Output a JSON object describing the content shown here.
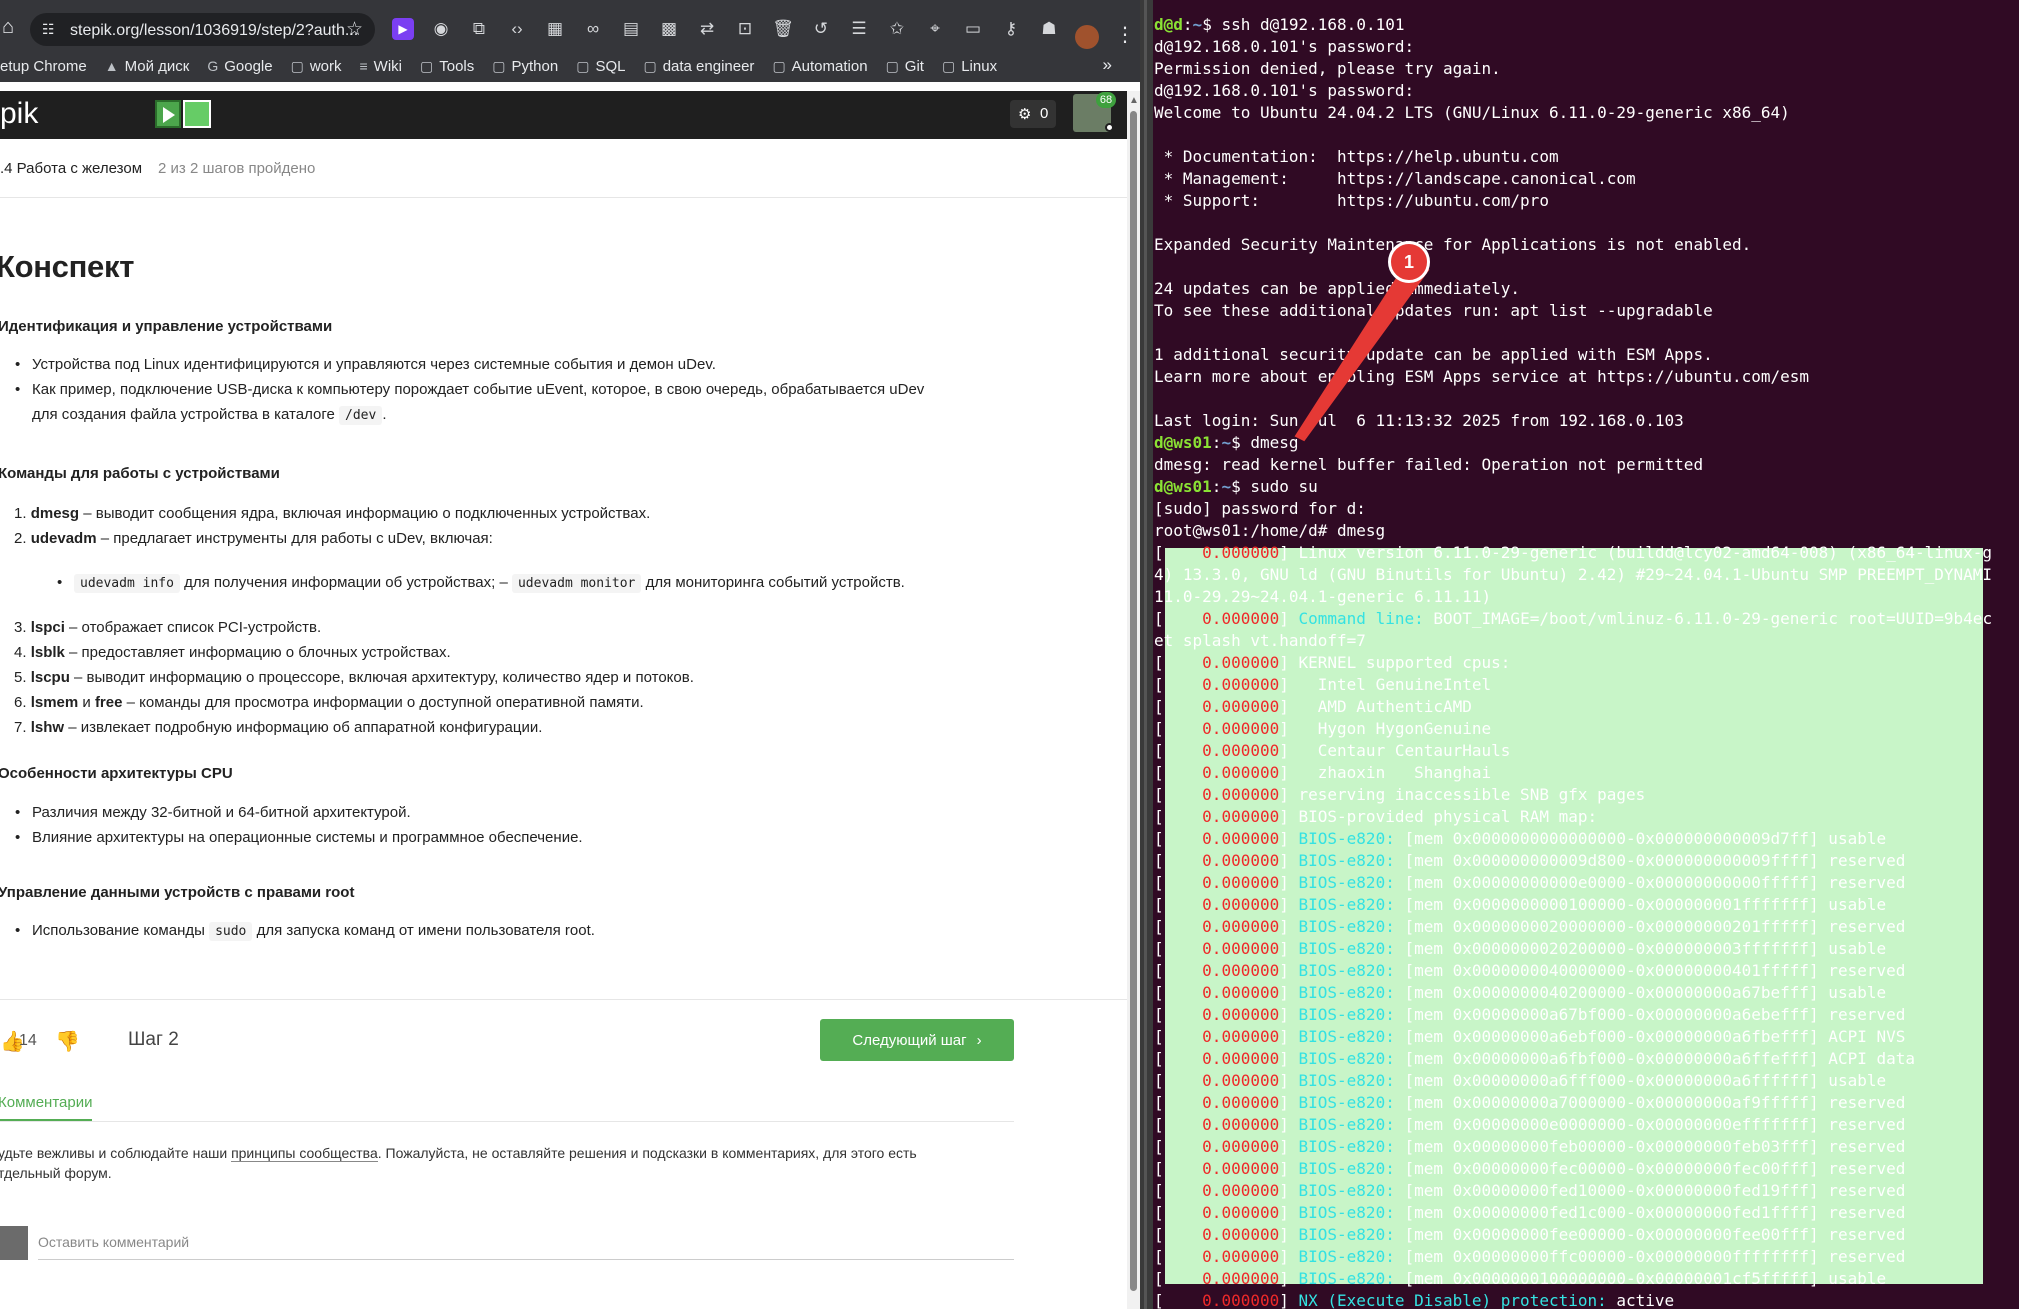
{
  "browser": {
    "url": "stepik.org/lesson/1036919/step/2?auth...",
    "extensions": [
      "play-icon",
      "globe-icon",
      "puzzle-icon",
      "code-icon",
      "table-icon",
      "link-icon",
      "reader-icon",
      "qr-icon",
      "translate-icon",
      "capture-icon",
      "trash-icon",
      "history-icon",
      "list-icon",
      "star-outline-icon",
      "location-icon",
      "card-icon",
      "key-icon",
      "incognito-icon"
    ],
    "bookmarks": [
      {
        "label": "etup Chrome",
        "icon": "page-icon"
      },
      {
        "label": "Мой диск",
        "icon": "drive-icon"
      },
      {
        "label": "Google",
        "icon": "google-icon"
      },
      {
        "label": "work",
        "icon": "folder-icon"
      },
      {
        "label": "Wiki",
        "icon": "wiki-icon"
      },
      {
        "label": "Tools",
        "icon": "folder-icon"
      },
      {
        "label": "Python",
        "icon": "folder-icon"
      },
      {
        "label": "SQL",
        "icon": "folder-icon"
      },
      {
        "label": "data engineer",
        "icon": "folder-icon"
      },
      {
        "label": "Automation",
        "icon": "folder-icon"
      },
      {
        "label": "Git",
        "icon": "folder-icon"
      },
      {
        "label": "Linux",
        "icon": "folder-icon"
      }
    ],
    "more": "»"
  },
  "stepik": {
    "logo": "pik",
    "notifications": "0",
    "user_badge": "68",
    "lesson_title": ".4 Работа с железом",
    "lesson_progress": "2 из 2 шагов пройдено",
    "heading": "Конспект",
    "sections": {
      "s1": "Идентификация и управление устройствами",
      "s2": "Команды для работы с устройствами",
      "s3": "Особенности архитектуры CPU",
      "s4": "Управление данными устройств с правами root"
    },
    "s1_items": [
      "Устройства под Linux идентифицируются и управляются через системные события и демон uDev.",
      "Как пример, подключение USB-диска к компьютеру порождает событие uEvent, которое, в свою очередь, обрабатывается uDev",
      "для создания файла устройства в каталоге"
    ],
    "s1_code": "/dev",
    "s1_after": ".",
    "cmds": [
      {
        "num": "1.",
        "cmd": "dmesg",
        "desc": " – выводит сообщения ядра, включая информацию о подключенных устройствах."
      },
      {
        "num": "2.",
        "cmd": "udevadm",
        "desc": " – предлагает инструменты для работы с uDev, включая:"
      }
    ],
    "udev_code1": "udevadm info",
    "udev_mid": "для получения информации об устройствах; –",
    "udev_code2": "udevadm monitor",
    "udev_end": "для мониторинга событий устройств.",
    "cmds2": [
      {
        "num": "3.",
        "cmd": "lspci",
        "desc": " – отображает список PCI-устройств."
      },
      {
        "num": "4.",
        "cmd": "lsblk",
        "desc": " – предоставляет информацию о блочных устройствах."
      },
      {
        "num": "5.",
        "cmd": "lscpu",
        "desc": " – выводит информацию о процессоре, включая архитектуру, количество ядер и потоков."
      },
      {
        "num": "6.",
        "cmd": "lsmem",
        "desc2": " и ",
        "cmd2": "free",
        "desc": " – команды для просмотра информации о доступной оперативной памяти."
      },
      {
        "num": "7.",
        "cmd": "lshw",
        "desc": " – извлекает подробную информацию об аппаратной конфигурации."
      }
    ],
    "s3_items": [
      "Различия между 32-битной и 64-битной архитектурой.",
      "Влияние архитектуры на операционные системы и программное обеспечение."
    ],
    "s4_before": "Использование команды",
    "s4_code": "sudo",
    "s4_after": "для запуска команд от имени пользователя root.",
    "likes": "14",
    "step_label": "Шаг 2",
    "next_button": "Следующий шаг",
    "comments_tab": "Комментарии",
    "rules_1": "удьте вежливы и соблюдайте наши ",
    "rules_link": "принципы сообщества",
    "rules_2": ". Пожалуйста, не оставляйте решения и подсказки в комментариях, для этого есть",
    "rules_3": "тдельный форум.",
    "comment_placeholder": "Оставить комментарий"
  },
  "annotation": {
    "badge": "1",
    "color": "#e53935"
  },
  "terminal": {
    "lines": [
      {
        "type": "prompt",
        "user": "d@d",
        "path": "~",
        "cmd": "ssh d@192.168.0.101"
      },
      {
        "type": "plain",
        "text": "d@192.168.0.101's password:"
      },
      {
        "type": "plain",
        "text": "Permission denied, please try again."
      },
      {
        "type": "plain",
        "text": "d@192.168.0.101's password:"
      },
      {
        "type": "plain",
        "text": "Welcome to Ubuntu 24.04.2 LTS (GNU/Linux 6.11.0-29-generic x86_64)"
      },
      {
        "type": "plain",
        "text": ""
      },
      {
        "type": "plain",
        "text": " * Documentation:  https://help.ubuntu.com"
      },
      {
        "type": "plain",
        "text": " * Management:     https://landscape.canonical.com"
      },
      {
        "type": "plain",
        "text": " * Support:        https://ubuntu.com/pro"
      },
      {
        "type": "plain",
        "text": ""
      },
      {
        "type": "plain",
        "text": "Expanded Security Maintenance for Applications is not enabled."
      },
      {
        "type": "plain",
        "text": ""
      },
      {
        "type": "plain",
        "text": "24 updates can be applied immediately."
      },
      {
        "type": "plain",
        "text": "To see these additional updates run: apt list --upgradable"
      },
      {
        "type": "plain",
        "text": ""
      },
      {
        "type": "plain",
        "text": "1 additional security update can be applied with ESM Apps."
      },
      {
        "type": "plain",
        "text": "Learn more about enabling ESM Apps service at https://ubuntu.com/esm"
      },
      {
        "type": "plain",
        "text": ""
      },
      {
        "type": "plain",
        "text": "Last login: Sun Jul  6 11:13:32 2025 from 192.168.0.103"
      },
      {
        "type": "prompt",
        "user": "d@ws01",
        "path": "~",
        "cmd": "dmesg"
      },
      {
        "type": "plain",
        "text": "dmesg: read kernel buffer failed: Operation not permitted"
      },
      {
        "type": "prompt",
        "user": "d@ws01",
        "path": "~",
        "cmd": "sudo su"
      },
      {
        "type": "plain",
        "text": "[sudo] password for d:"
      },
      {
        "type": "plain",
        "text": "root@ws01:/home/d# dmesg"
      },
      {
        "type": "kern",
        "ts": "    0.000000",
        "text": "Linux version 6.11.0-29-generic (buildd@lcy02-amd64-008) (x86_64-linux-g"
      },
      {
        "type": "hl",
        "text": "4) 13.3.0, GNU ld (GNU Binutils for Ubuntu) 2.42) #29~24.04.1-Ubuntu SMP PREEMPT_DYNAMI"
      },
      {
        "type": "hl",
        "text": "11.0-29.29~24.04.1-generic 6.11.11)"
      },
      {
        "type": "kernbios",
        "ts": "    0.000000",
        "tag": "Command line:",
        "text": " BOOT_IMAGE=/boot/vmlinuz-6.11.0-29-generic root=UUID=9b4ec"
      },
      {
        "type": "hl",
        "text": "et splash vt.handoff=7"
      },
      {
        "type": "kern",
        "ts": "    0.000000",
        "text": "KERNEL supported cpus:"
      },
      {
        "type": "kern",
        "ts": "    0.000000",
        "text": "  Intel GenuineIntel"
      },
      {
        "type": "kern",
        "ts": "    0.000000",
        "text": "  AMD AuthenticAMD"
      },
      {
        "type": "kern",
        "ts": "    0.000000",
        "text": "  Hygon HygonGenuine"
      },
      {
        "type": "kern",
        "ts": "    0.000000",
        "text": "  Centaur CentaurHauls"
      },
      {
        "type": "kern",
        "ts": "    0.000000",
        "text": "  zhaoxin   Shanghai"
      },
      {
        "type": "kern",
        "ts": "    0.000000",
        "text": "reserving inaccessible SNB gfx pages"
      },
      {
        "type": "kern",
        "ts": "    0.000000",
        "text": "BIOS-provided physical RAM map:"
      },
      {
        "type": "kernbios",
        "ts": "    0.000000",
        "tag": "BIOS-e820:",
        "text": " [mem 0x0000000000000000-0x000000000009d7ff] usable"
      },
      {
        "type": "kernbios",
        "ts": "    0.000000",
        "tag": "BIOS-e820:",
        "text": " [mem 0x000000000009d800-0x000000000009ffff] reserved"
      },
      {
        "type": "kernbios",
        "ts": "    0.000000",
        "tag": "BIOS-e820:",
        "text": " [mem 0x00000000000e0000-0x00000000000fffff] reserved"
      },
      {
        "type": "kernbios",
        "ts": "    0.000000",
        "tag": "BIOS-e820:",
        "text": " [mem 0x0000000000100000-0x000000001fffffff] usable"
      },
      {
        "type": "kernbios",
        "ts": "    0.000000",
        "tag": "BIOS-e820:",
        "text": " [mem 0x0000000020000000-0x00000000201fffff] reserved"
      },
      {
        "type": "kernbios",
        "ts": "    0.000000",
        "tag": "BIOS-e820:",
        "text": " [mem 0x0000000020200000-0x000000003fffffff] usable"
      },
      {
        "type": "kernbios",
        "ts": "    0.000000",
        "tag": "BIOS-e820:",
        "text": " [mem 0x0000000040000000-0x00000000401fffff] reserved"
      },
      {
        "type": "kernbios",
        "ts": "    0.000000",
        "tag": "BIOS-e820:",
        "text": " [mem 0x0000000040200000-0x00000000a67befff] usable"
      },
      {
        "type": "kernbios",
        "ts": "    0.000000",
        "tag": "BIOS-e820:",
        "text": " [mem 0x00000000a67bf000-0x00000000a6ebefff] reserved"
      },
      {
        "type": "kernbios",
        "ts": "    0.000000",
        "tag": "BIOS-e820:",
        "text": " [mem 0x00000000a6ebf000-0x00000000a6fbefff] ACPI NVS"
      },
      {
        "type": "kernbios",
        "ts": "    0.000000",
        "tag": "BIOS-e820:",
        "text": " [mem 0x00000000a6fbf000-0x00000000a6ffefff] ACPI data"
      },
      {
        "type": "kernbios",
        "ts": "    0.000000",
        "tag": "BIOS-e820:",
        "text": " [mem 0x00000000a6fff000-0x00000000a6ffffff] usable"
      },
      {
        "type": "kernbios",
        "ts": "    0.000000",
        "tag": "BIOS-e820:",
        "text": " [mem 0x00000000a7000000-0x00000000af9fffff] reserved"
      },
      {
        "type": "kernbios",
        "ts": "    0.000000",
        "tag": "BIOS-e820:",
        "text": " [mem 0x00000000e0000000-0x00000000efffffff] reserved"
      },
      {
        "type": "kernbios",
        "ts": "    0.000000",
        "tag": "BIOS-e820:",
        "text": " [mem 0x00000000feb00000-0x00000000feb03fff] reserved"
      },
      {
        "type": "kernbios",
        "ts": "    0.000000",
        "tag": "BIOS-e820:",
        "text": " [mem 0x00000000fec00000-0x00000000fec00fff] reserved"
      },
      {
        "type": "kernbios",
        "ts": "    0.000000",
        "tag": "BIOS-e820:",
        "text": " [mem 0x00000000fed10000-0x00000000fed19fff] reserved"
      },
      {
        "type": "kernbios",
        "ts": "    0.000000",
        "tag": "BIOS-e820:",
        "text": " [mem 0x00000000fed1c000-0x00000000fed1ffff] reserved"
      },
      {
        "type": "kernbios",
        "ts": "    0.000000",
        "tag": "BIOS-e820:",
        "text": " [mem 0x00000000fee00000-0x00000000fee00fff] reserved"
      },
      {
        "type": "kernbios",
        "ts": "    0.000000",
        "tag": "BIOS-e820:",
        "text": " [mem 0x00000000ffc00000-0x00000000ffffffff] reserved"
      },
      {
        "type": "kernbios",
        "ts": "    0.000000",
        "tag": "BIOS-e820:",
        "text": " [mem 0x0000000100000000-0x00000001cf5fffff] usable"
      },
      {
        "type": "kernlast",
        "ts": "    0.000000",
        "tag": "NX (Execute Disable) protection:",
        "text": " active"
      }
    ]
  }
}
